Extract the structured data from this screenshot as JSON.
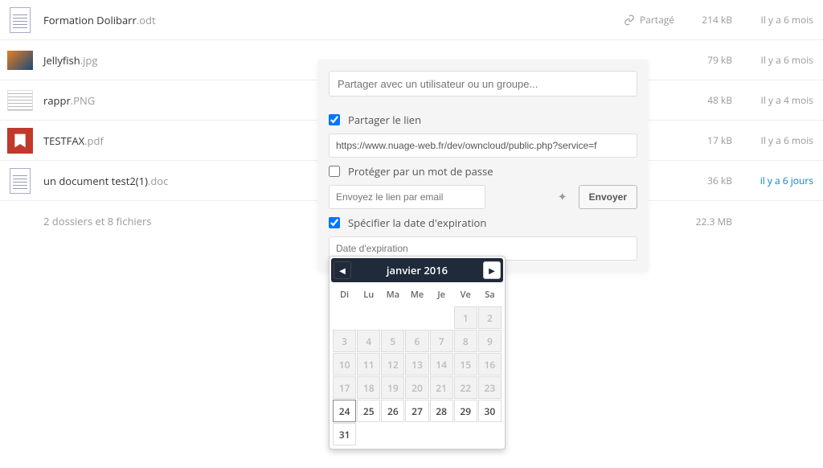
{
  "files": [
    {
      "name": "Formation Dolibarr",
      "ext": ".odt",
      "shared": "Partagé",
      "size": "214 kB",
      "date": "Il y a 6 mois",
      "type": "doc"
    },
    {
      "name": "Jellyfish",
      "ext": ".jpg",
      "shared": "",
      "size": "79 kB",
      "date": "Il y a 6 mois",
      "type": "jelly"
    },
    {
      "name": "rappr",
      "ext": ".PNG",
      "shared": "",
      "size": "48 kB",
      "date": "Il y a 4 mois",
      "type": "rappr"
    },
    {
      "name": "TESTFAX",
      "ext": ".pdf",
      "shared": "",
      "size": "17 kB",
      "date": "Il y a 6 mois",
      "type": "pdf"
    },
    {
      "name": "un document test2(1)",
      "ext": ".doc",
      "shared": "",
      "size": "36 kB",
      "date": "il y a 6 jours",
      "type": "doc",
      "recent": true
    }
  ],
  "summary": {
    "text": "2 dossiers et 8 fichiers",
    "size": "22.3 MB"
  },
  "share": {
    "search_placeholder": "Partager avec un utilisateur ou un groupe...",
    "share_link_label": "Partager le lien",
    "url": "https://www.nuage-web.fr/dev/owncloud/public.php?service=f",
    "password_label": "Protéger par un mot de passe",
    "email_placeholder": "Envoyez le lien par email",
    "send_label": "Envoyer",
    "expire_label": "Spécifier la date d'expiration",
    "expire_placeholder": "Date d'expiration"
  },
  "calendar": {
    "title": "janvier 2016",
    "dow": [
      "Di",
      "Lu",
      "Ma",
      "Me",
      "Je",
      "Ve",
      "Sa"
    ],
    "weeks": [
      [
        null,
        null,
        null,
        null,
        null,
        {
          "d": 1,
          "s": "past"
        },
        {
          "d": 2,
          "s": "past"
        }
      ],
      [
        {
          "d": 3,
          "s": "past"
        },
        {
          "d": 4,
          "s": "past"
        },
        {
          "d": 5,
          "s": "past"
        },
        {
          "d": 6,
          "s": "past"
        },
        {
          "d": 7,
          "s": "past"
        },
        {
          "d": 8,
          "s": "past"
        },
        {
          "d": 9,
          "s": "past"
        }
      ],
      [
        {
          "d": 10,
          "s": "past"
        },
        {
          "d": 11,
          "s": "past"
        },
        {
          "d": 12,
          "s": "past"
        },
        {
          "d": 13,
          "s": "past"
        },
        {
          "d": 14,
          "s": "past"
        },
        {
          "d": 15,
          "s": "past"
        },
        {
          "d": 16,
          "s": "past"
        }
      ],
      [
        {
          "d": 17,
          "s": "past"
        },
        {
          "d": 18,
          "s": "past"
        },
        {
          "d": 19,
          "s": "past"
        },
        {
          "d": 20,
          "s": "past"
        },
        {
          "d": 21,
          "s": "past"
        },
        {
          "d": 22,
          "s": "past"
        },
        {
          "d": 23,
          "s": "past"
        }
      ],
      [
        {
          "d": 24,
          "s": "today"
        },
        {
          "d": 25,
          "s": ""
        },
        {
          "d": 26,
          "s": ""
        },
        {
          "d": 27,
          "s": ""
        },
        {
          "d": 28,
          "s": ""
        },
        {
          "d": 29,
          "s": ""
        },
        {
          "d": 30,
          "s": ""
        }
      ],
      [
        {
          "d": 31,
          "s": ""
        },
        null,
        null,
        null,
        null,
        null,
        null
      ]
    ]
  }
}
